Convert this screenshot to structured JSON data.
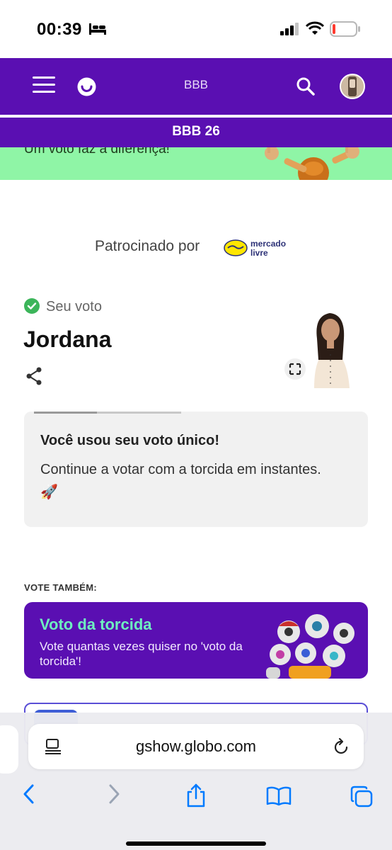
{
  "status_bar": {
    "time": "00:39",
    "battery_level": 0.1
  },
  "header": {
    "brand_label": "BBB",
    "section_title": "BBB 26",
    "icons": [
      "menu-icon",
      "gshow-logo-icon",
      "search-icon",
      "avatar"
    ]
  },
  "banner": {
    "text": "Um voto faz a diferença!",
    "color": "#8ff5a6"
  },
  "sponsor": {
    "label": "Patrocinado por",
    "brand": "mercado livre"
  },
  "vote": {
    "status_label": "Seu voto",
    "candidate_name": "Jordana"
  },
  "info_card": {
    "title": "Você usou seu voto único!",
    "body": "Continue a votar com a torcida em instantes. 🚀",
    "timer_progress": 0.43
  },
  "vote_also": {
    "heading": "VOTE TAMBÉM:",
    "card_title": "Voto da torcida",
    "card_subtitle": "Vote quantas vezes quiser no 'voto da torcida'!"
  },
  "browser": {
    "url": "gshow.globo.com",
    "toolbar": [
      "back-icon",
      "forward-icon",
      "share-icon",
      "bookmarks-icon",
      "tabs-icon"
    ]
  },
  "colors": {
    "brand_purple": "#5a0fb2",
    "accent_green": "#6ef0c0",
    "link_blue": "#007aff"
  }
}
